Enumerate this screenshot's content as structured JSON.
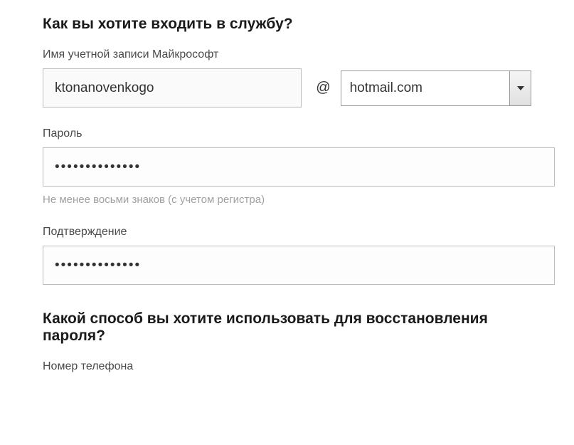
{
  "section1": {
    "heading": "Как вы хотите входить в службу?",
    "account_label": "Имя учетной записи Майкрософт",
    "username_value": "ktonanovenkogo",
    "at_symbol": "@",
    "domain_selected": "hotmail.com",
    "password_label": "Пароль",
    "password_value": "••••••••••••••",
    "password_hint": "Не менее восьми знаков (с учетом регистра)",
    "confirm_label": "Подтверждение",
    "confirm_value": "••••••••••••••"
  },
  "section2": {
    "heading": "Какой способ вы хотите использовать для восстановления пароля?",
    "phone_label": "Номер телефона"
  }
}
